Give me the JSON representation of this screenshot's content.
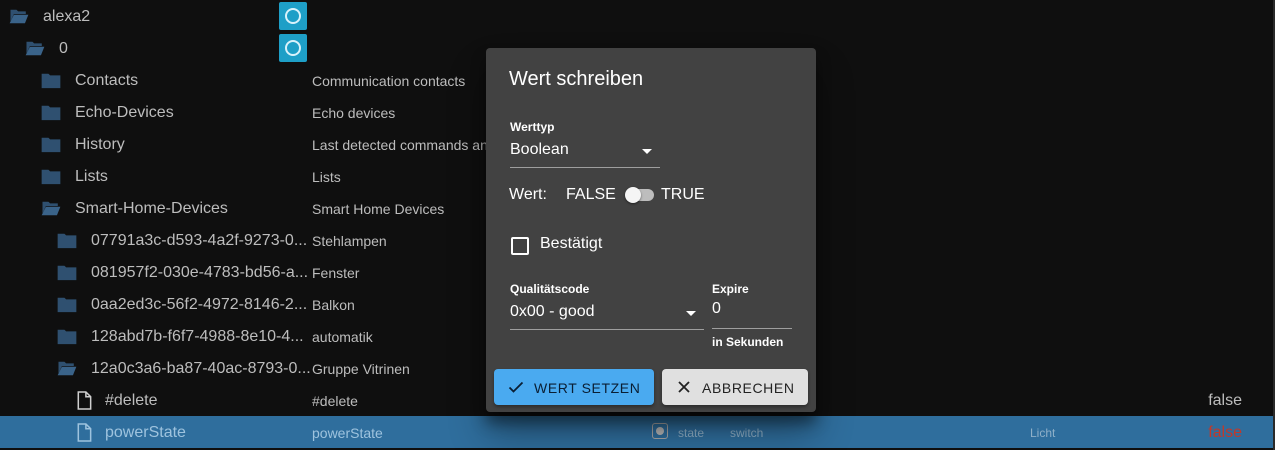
{
  "tree": {
    "root": {
      "name": "alexa2"
    },
    "instance": {
      "name": "0"
    },
    "channels": [
      {
        "name": "Contacts",
        "desc": "Communication contacts"
      },
      {
        "name": "Echo-Devices",
        "desc": "Echo devices"
      },
      {
        "name": "History",
        "desc": "Last detected commands and"
      },
      {
        "name": "Lists",
        "desc": "Lists"
      },
      {
        "name": "Smart-Home-Devices",
        "desc": "Smart Home Devices"
      }
    ],
    "devices": [
      {
        "name": "07791a3c-d593-4a2f-9273-0...",
        "desc": "Stehlampen"
      },
      {
        "name": "081957f2-030e-4783-bd56-a...",
        "desc": "Fenster"
      },
      {
        "name": "0aa2ed3c-56f2-4972-8146-2...",
        "desc": "Balkon"
      },
      {
        "name": "128abd7b-f6f7-4988-8e10-4...",
        "desc": "automatik"
      },
      {
        "name": "12a0c3a6-ba87-40ac-8793-0...",
        "desc": "Gruppe Vitrinen"
      }
    ],
    "states": [
      {
        "name": "#delete",
        "desc": "#delete",
        "value": "false"
      },
      {
        "name": "powerState",
        "desc": "powerState",
        "type": "state",
        "role": "switch",
        "room": "Licht",
        "value": "false"
      }
    ]
  },
  "dialog": {
    "title": "Wert schreiben",
    "type_label": "Werttyp",
    "type_value": "Boolean",
    "wert_label": "Wert:",
    "false_label": "FALSE",
    "true_label": "TRUE",
    "switch_on": false,
    "confirmed_label": "Bestätigt",
    "confirmed_checked": false,
    "quality_label": "Qualitätscode",
    "quality_value": "0x00 - good",
    "expire_label": "Expire",
    "expire_value": "0",
    "expire_helper": "in Sekunden",
    "submit_label": "WERT SETZEN",
    "cancel_label": "ABBRECHEN"
  },
  "colors": {
    "background": "#0f0f0f",
    "folder": "#2f5070",
    "selection": "#2f6e9d",
    "badge": "#1e9fc7",
    "dialog": "#424242",
    "primary_button": "#4aaaf0",
    "false_value_selected": "#c0392b"
  },
  "icons": [
    "folder-open-icon",
    "folder-icon",
    "file-icon",
    "alexa-icon",
    "checkmark-icon",
    "close-icon",
    "caret-down-icon"
  ]
}
